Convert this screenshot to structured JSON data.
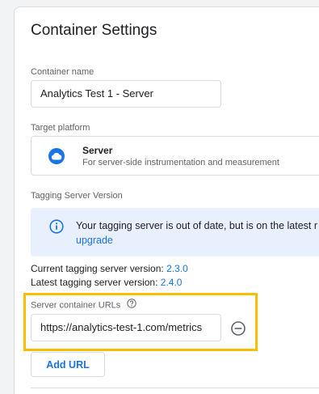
{
  "title": "Container Settings",
  "container_name": {
    "label": "Container name",
    "value": "Analytics Test 1 - Server"
  },
  "target_platform": {
    "label": "Target platform",
    "name": "Server",
    "description": "For server-side instrumentation and measurement",
    "icon": "cloud-icon"
  },
  "tagging_server": {
    "label": "Tagging Server Version",
    "notice_text": "Your tagging server is out of date, but is on the latest r",
    "notice_link": "upgrade",
    "current_label": "Current tagging server version: ",
    "current_version": "2.3.0",
    "latest_label": "Latest tagging server version: ",
    "latest_version": "2.4.0"
  },
  "server_urls": {
    "label": "Server container URLs",
    "urls": [
      "https://analytics-test-1.com/metrics"
    ],
    "add_label": "Add URL"
  },
  "colors": {
    "accent": "#1a73e8",
    "highlight": "#fbbc04",
    "info_background": "#e8f0fe"
  }
}
